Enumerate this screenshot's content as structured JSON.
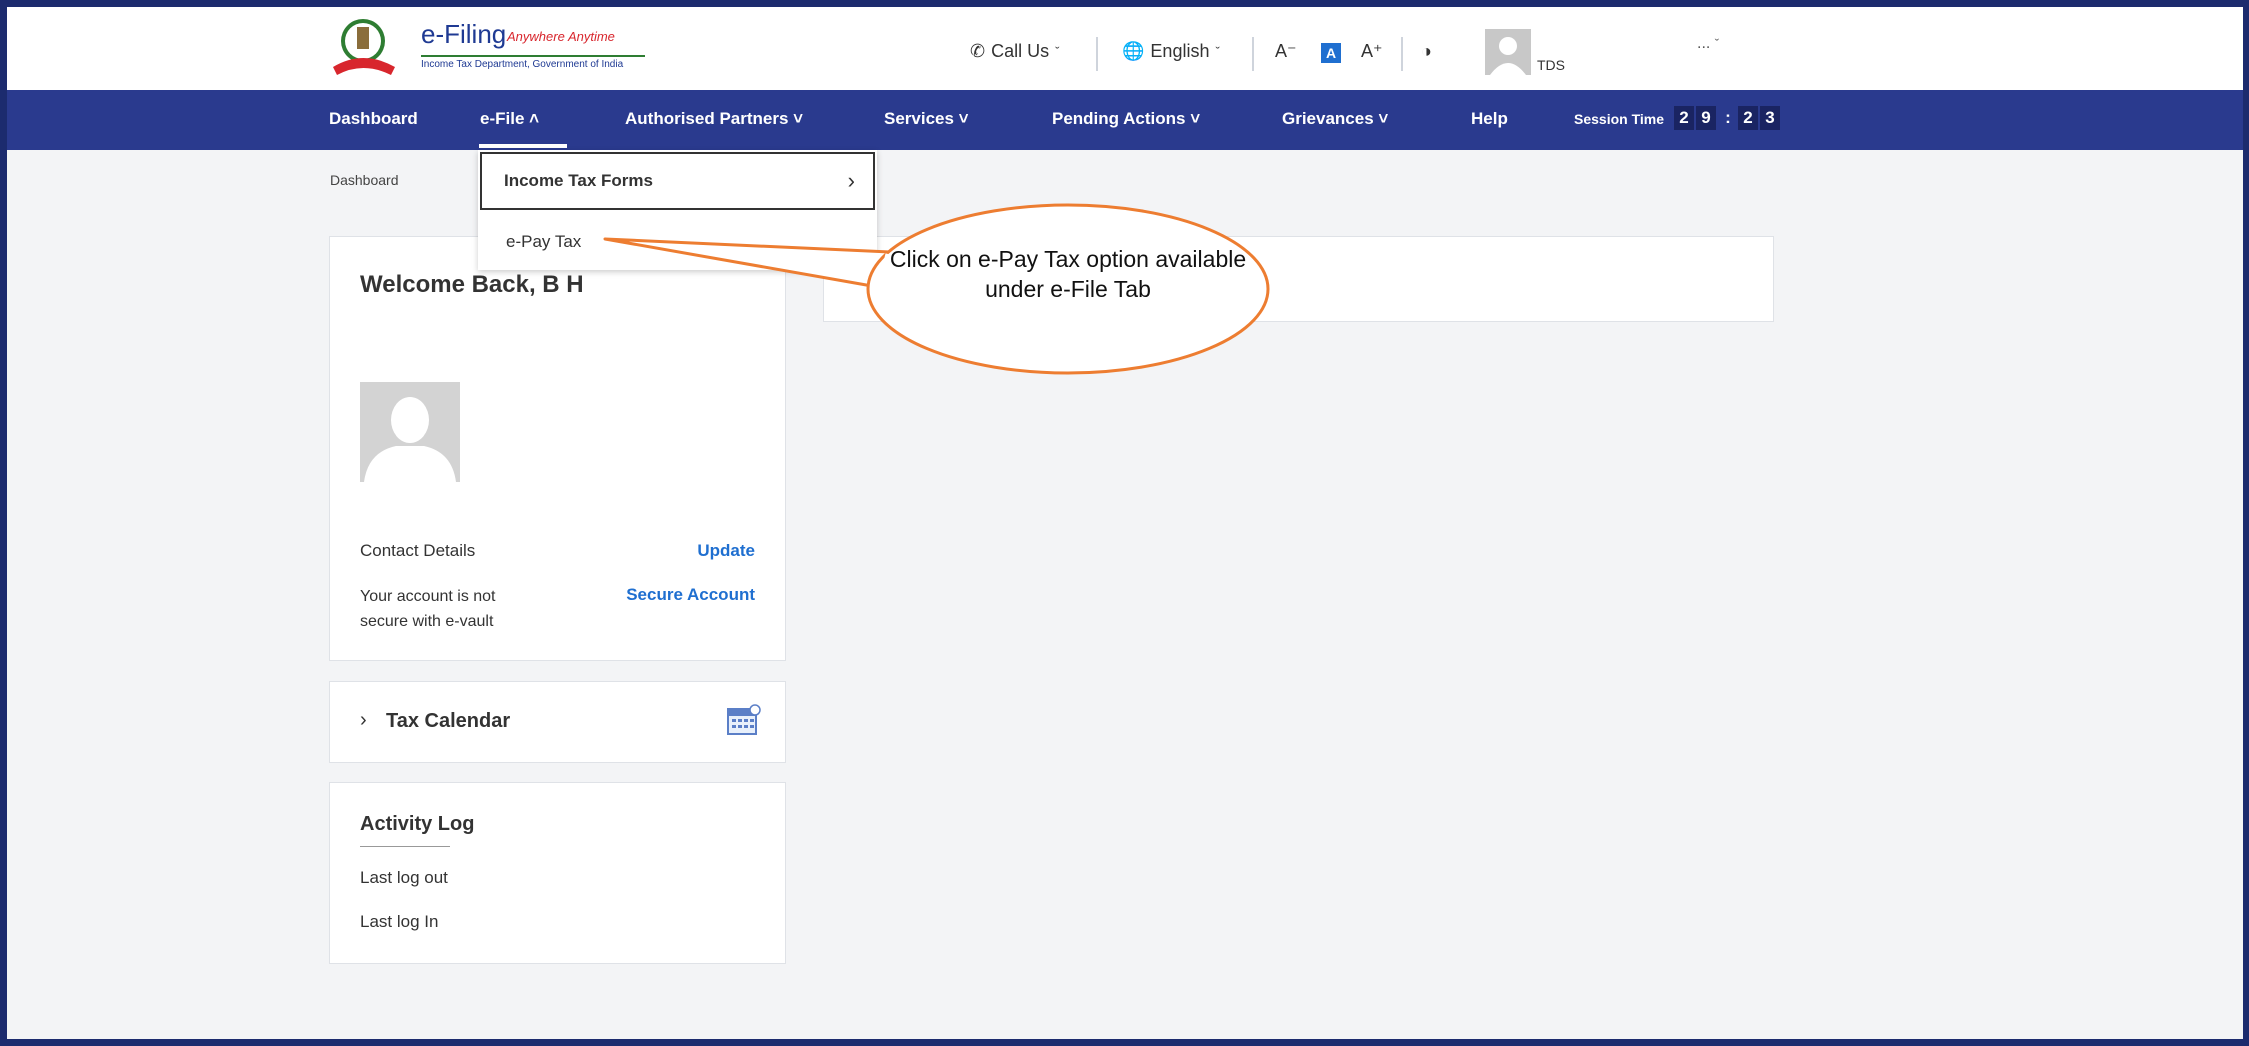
{
  "header": {
    "logo_title": "e-Filing",
    "logo_tagline": "Anywhere Anytime",
    "logo_subtitle": "Income Tax Department, Government of India",
    "call_us": "Call Us",
    "language": "English",
    "font_decrease": "A⁻",
    "font_default": "A",
    "font_increase": "A⁺",
    "user_type": "TDS",
    "more": "..."
  },
  "nav": {
    "items": [
      {
        "label": "Dashboard"
      },
      {
        "label": "e-File ˄"
      },
      {
        "label": "Authorised Partners ˅"
      },
      {
        "label": "Services ˅"
      },
      {
        "label": "Pending Actions ˅"
      },
      {
        "label": "Grievances ˅"
      },
      {
        "label": "Help"
      }
    ],
    "session_label": "Session Time",
    "session_digits": [
      "2",
      "9",
      ":",
      "2",
      "3"
    ]
  },
  "breadcrumb": "Dashboard",
  "dropdown": {
    "item1": "Income Tax Forms",
    "item2": "e-Pay Tax"
  },
  "welcome": {
    "title": "Welcome Back, B H",
    "contact_label": "Contact Details",
    "update_link": "Update",
    "secure_text": "Your account is not secure with e-vault",
    "secure_link": "Secure Account"
  },
  "tax_calendar": {
    "title": "Tax Calendar"
  },
  "activity_log": {
    "title": "Activity Log",
    "items": [
      "Last log out",
      "Last log In"
    ]
  },
  "callout": {
    "text": "Click on e-Pay Tax option available under e-File Tab"
  },
  "colors": {
    "nav_bg": "#2a3a8e",
    "link": "#1f6fd0",
    "callout_stroke": "#ed7d31"
  }
}
